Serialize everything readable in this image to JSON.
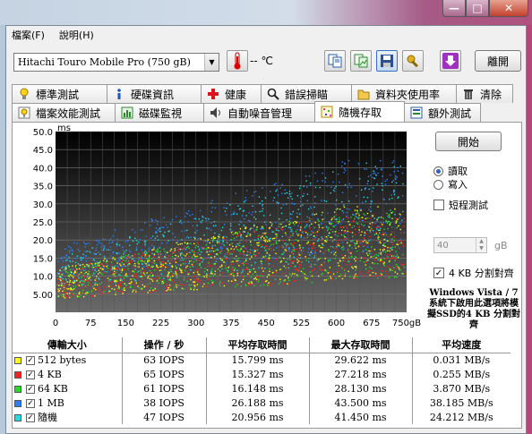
{
  "window": {
    "buttons": {
      "min": "—",
      "max": "□",
      "close": "✕"
    }
  },
  "menu": [
    {
      "label": "檔案(F)"
    },
    {
      "label": "說明(H)"
    }
  ],
  "toolbar": {
    "drive": "Hitachi Touro Mobile Pro (750 gB)",
    "temp": "-- ℃",
    "exit_label": "離開"
  },
  "tabs_row1": [
    {
      "label": "標準測試",
      "icon": "bulb-icon"
    },
    {
      "label": "硬碟資訊",
      "icon": "info-icon"
    },
    {
      "label": "健康",
      "icon": "health-cross-icon"
    },
    {
      "label": "錯誤掃瞄",
      "icon": "magnifier-icon"
    },
    {
      "label": "資料夾使用率",
      "icon": "folder-icon"
    },
    {
      "label": "清除",
      "icon": "trash-icon"
    }
  ],
  "tabs_row2": [
    {
      "label": "檔案效能測試",
      "icon": "file-bulb-icon"
    },
    {
      "label": "磁碟監視",
      "icon": "monitor-chart-icon"
    },
    {
      "label": "自動噪音管理",
      "icon": "speaker-icon"
    },
    {
      "label": "隨機存取",
      "icon": "random-access-icon",
      "active": true
    },
    {
      "label": "額外測試",
      "icon": "extra-test-icon"
    }
  ],
  "side": {
    "start_label": "開始",
    "read_label": "讀取",
    "write_label": "寫入",
    "short_test_label": "短程測試",
    "short_test_value": "40",
    "gb_label": "gB",
    "align_label": "4 KB 分割對齊",
    "note": "Windows Vista / 7 系統下啟用此選項將模擬SSD的4 KB 分割對齊"
  },
  "chart_data": {
    "type": "scatter",
    "ylabel": "ms",
    "xlabel": "gB",
    "ylim": [
      0,
      50
    ],
    "xlim": [
      0,
      750
    ],
    "yticks": [
      "50.0",
      "45.0",
      "40.0",
      "35.0",
      "30.0",
      "25.0",
      "20.0",
      "15.0",
      "10.0",
      "5.00"
    ],
    "xticks": [
      "0",
      "75",
      "150",
      "225",
      "300",
      "375",
      "450",
      "525",
      "600",
      "675",
      "750gB"
    ],
    "grid": true,
    "series": [
      {
        "name": "512 bytes",
        "color": "#ffff00",
        "min_ms": 4,
        "max_ms": 29.6,
        "avg_ms": 15.8
      },
      {
        "name": "4 KB",
        "color": "#ff2020",
        "min_ms": 4,
        "max_ms": 27.2,
        "avg_ms": 15.3
      },
      {
        "name": "64 KB",
        "color": "#22dd22",
        "min_ms": 4,
        "max_ms": 28.1,
        "avg_ms": 16.1
      },
      {
        "name": "1 MB",
        "color": "#2a7fff",
        "min_ms": 10,
        "max_ms": 43.5,
        "avg_ms": 26.2
      },
      {
        "name": "隨機",
        "color": "#22dddd",
        "min_ms": 7,
        "max_ms": 41.5,
        "avg_ms": 21.0
      }
    ]
  },
  "results": {
    "headers": [
      "傳輸大小",
      "操作 / 秒",
      "平均存取時間",
      "最大存取時間",
      "平均速度"
    ],
    "rows": [
      {
        "size": "512 bytes",
        "color": "#ffff00",
        "iops": "63 IOPS",
        "avg": "15.799 ms",
        "max": "29.622 ms",
        "speed": "0.031 MB/s"
      },
      {
        "size": "4 KB",
        "color": "#ff2020",
        "iops": "65 IOPS",
        "avg": "15.327 ms",
        "max": "27.218 ms",
        "speed": "0.255 MB/s"
      },
      {
        "size": "64 KB",
        "color": "#22dd22",
        "iops": "61 IOPS",
        "avg": "16.148 ms",
        "max": "28.130 ms",
        "speed": "3.870 MB/s"
      },
      {
        "size": "1 MB",
        "color": "#2a7fff",
        "iops": "38 IOPS",
        "avg": "26.188 ms",
        "max": "43.500 ms",
        "speed": "38.185 MB/s"
      },
      {
        "size": "隨機",
        "color": "#22dddd",
        "iops": "47 IOPS",
        "avg": "20.956 ms",
        "max": "41.450 ms",
        "speed": "24.212 MB/s"
      }
    ]
  }
}
